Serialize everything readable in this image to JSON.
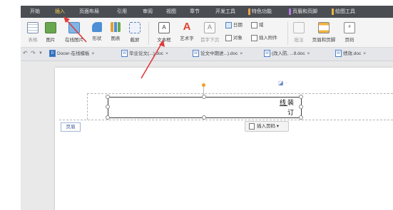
{
  "menu": {
    "items": [
      {
        "label": "开始"
      },
      {
        "label": "插入"
      },
      {
        "label": "页面布局"
      },
      {
        "label": "引用"
      },
      {
        "label": "审阅"
      },
      {
        "label": "视图"
      },
      {
        "label": "章节"
      },
      {
        "label": "开发工具"
      },
      {
        "label": "特色功能"
      },
      {
        "label": "页眉和页脚"
      },
      {
        "label": "绘图工具"
      }
    ]
  },
  "ribbon": {
    "table": "表格",
    "picture": "图片",
    "online_picture": "在线图片",
    "shapes": "形状",
    "chart": "图表",
    "screenshot": "截屏",
    "textbox": "文本框",
    "wordart": "艺术字",
    "top_bottom": "首字下沉",
    "date": "日期",
    "field": "域",
    "object": "对象",
    "insert_attachment": "插入附件",
    "comment": "批注",
    "header_footer": "页眉和页脚",
    "page_number": "页码"
  },
  "tabs": {
    "items": [
      {
        "label": "Docer-在线模板",
        "close": "×"
      },
      {
        "label": "毕业论文(...).doc",
        "close": "×"
      },
      {
        "label": "论文中期进...).doc",
        "close": "×"
      },
      {
        "label": "(改入防, ...8.doc",
        "close": "×"
      },
      {
        "label": "绩效.doc",
        "close": "×"
      }
    ]
  },
  "document": {
    "textbox_line1_part1": "线",
    "textbox_line1_part2": "装",
    "textbox_line2": "订",
    "header_label": "页眉",
    "insert_page_number": "插入页码"
  },
  "colors": {
    "menubar_bg": "#4a4e53",
    "active_menu": "#ffd24a",
    "arrow": "#e03a3a"
  }
}
